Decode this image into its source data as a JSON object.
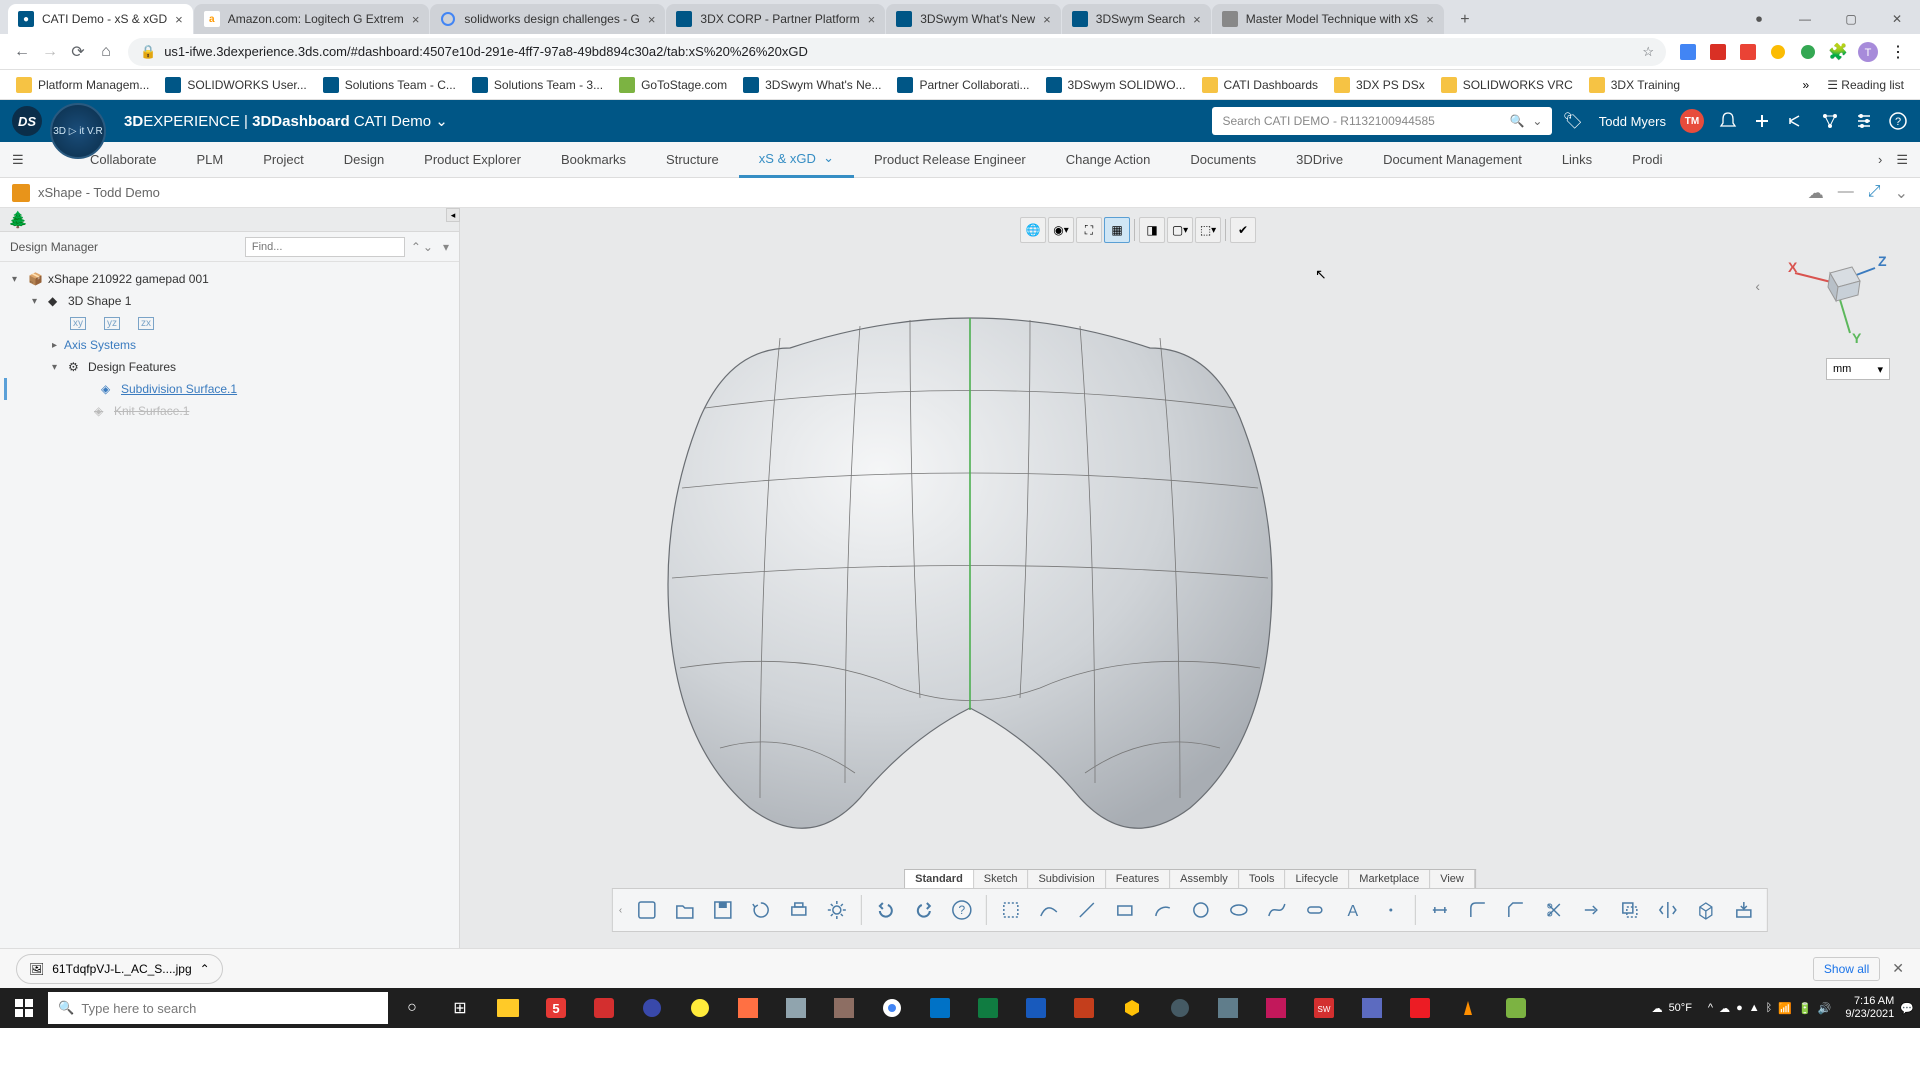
{
  "browser": {
    "tabs": [
      {
        "title": "CATI Demo - xS & xGD",
        "active": true,
        "fav": "#005686"
      },
      {
        "title": "Amazon.com: Logitech G Extrem",
        "active": false,
        "fav": "#ff9900"
      },
      {
        "title": "solidworks design challenges - G",
        "active": false,
        "fav": "#4285f4"
      },
      {
        "title": "3DX CORP - Partner Platform",
        "active": false,
        "fav": "#005686"
      },
      {
        "title": "3DSwym What's New",
        "active": false,
        "fav": "#005686"
      },
      {
        "title": "3DSwym Search",
        "active": false,
        "fav": "#005686"
      },
      {
        "title": "Master Model Technique with xS",
        "active": false,
        "fav": "#888"
      }
    ],
    "url": "us1-ifwe.3dexperience.3ds.com/#dashboard:4507e10d-291e-4ff7-97a8-49bd894c30a2/tab:xS%20%26%20xGD",
    "bookmarks": [
      "Platform Managem...",
      "SOLIDWORKS User...",
      "Solutions Team - C...",
      "Solutions Team - 3...",
      "GoToStage.com",
      "3DSwym What's Ne...",
      "Partner Collaborati...",
      "3DSwym SOLIDWO...",
      "CATI Dashboards",
      "3DX PS DSx",
      "SOLIDWORKS VRC",
      "3DX Training"
    ],
    "reading_list": "Reading list"
  },
  "dx": {
    "brand_a": "3D",
    "brand_b": "EXPERIENCE | ",
    "brand_c": "3DDashboard",
    "brand_d": " CATI Demo",
    "search_ph": "Search CATI DEMO - R1132100944585",
    "user": "Todd Myers",
    "avatar": "TM",
    "compass": "3D ▷ it\nV.R",
    "nav": [
      "Collaborate",
      "PLM",
      "Project",
      "Design",
      "Product Explorer",
      "Bookmarks",
      "Structure",
      "xS & xGD",
      "Product Release Engineer",
      "Change Action",
      "Documents",
      "3DDrive",
      "Document Management",
      "Links",
      "Prodi"
    ],
    "nav_active": 7
  },
  "xs": {
    "title": "xShape - Todd Demo"
  },
  "tree": {
    "panel": "Design Manager",
    "find_ph": "Find...",
    "root": "xShape 210922 gamepad 001",
    "shape": "3D Shape 1",
    "axis": "Axis Systems",
    "features": "Design Features",
    "subdiv": "Subdivision Surface.1",
    "knit": "Knit Surface.1"
  },
  "units": "mm",
  "triad": {
    "x": "X",
    "y": "Y",
    "z": "Z"
  },
  "tool_tabs": [
    "Standard",
    "Sketch",
    "Subdivision",
    "Features",
    "Assembly",
    "Tools",
    "Lifecycle",
    "Marketplace",
    "View"
  ],
  "tool_tabs_active": 0,
  "download": {
    "file": "61TdqfpVJ-L._AC_S....jpg",
    "showall": "Show all"
  },
  "taskbar": {
    "search_ph": "Type here to search",
    "weather": "50°F",
    "time": "7:16 AM",
    "date": "9/23/2021"
  }
}
